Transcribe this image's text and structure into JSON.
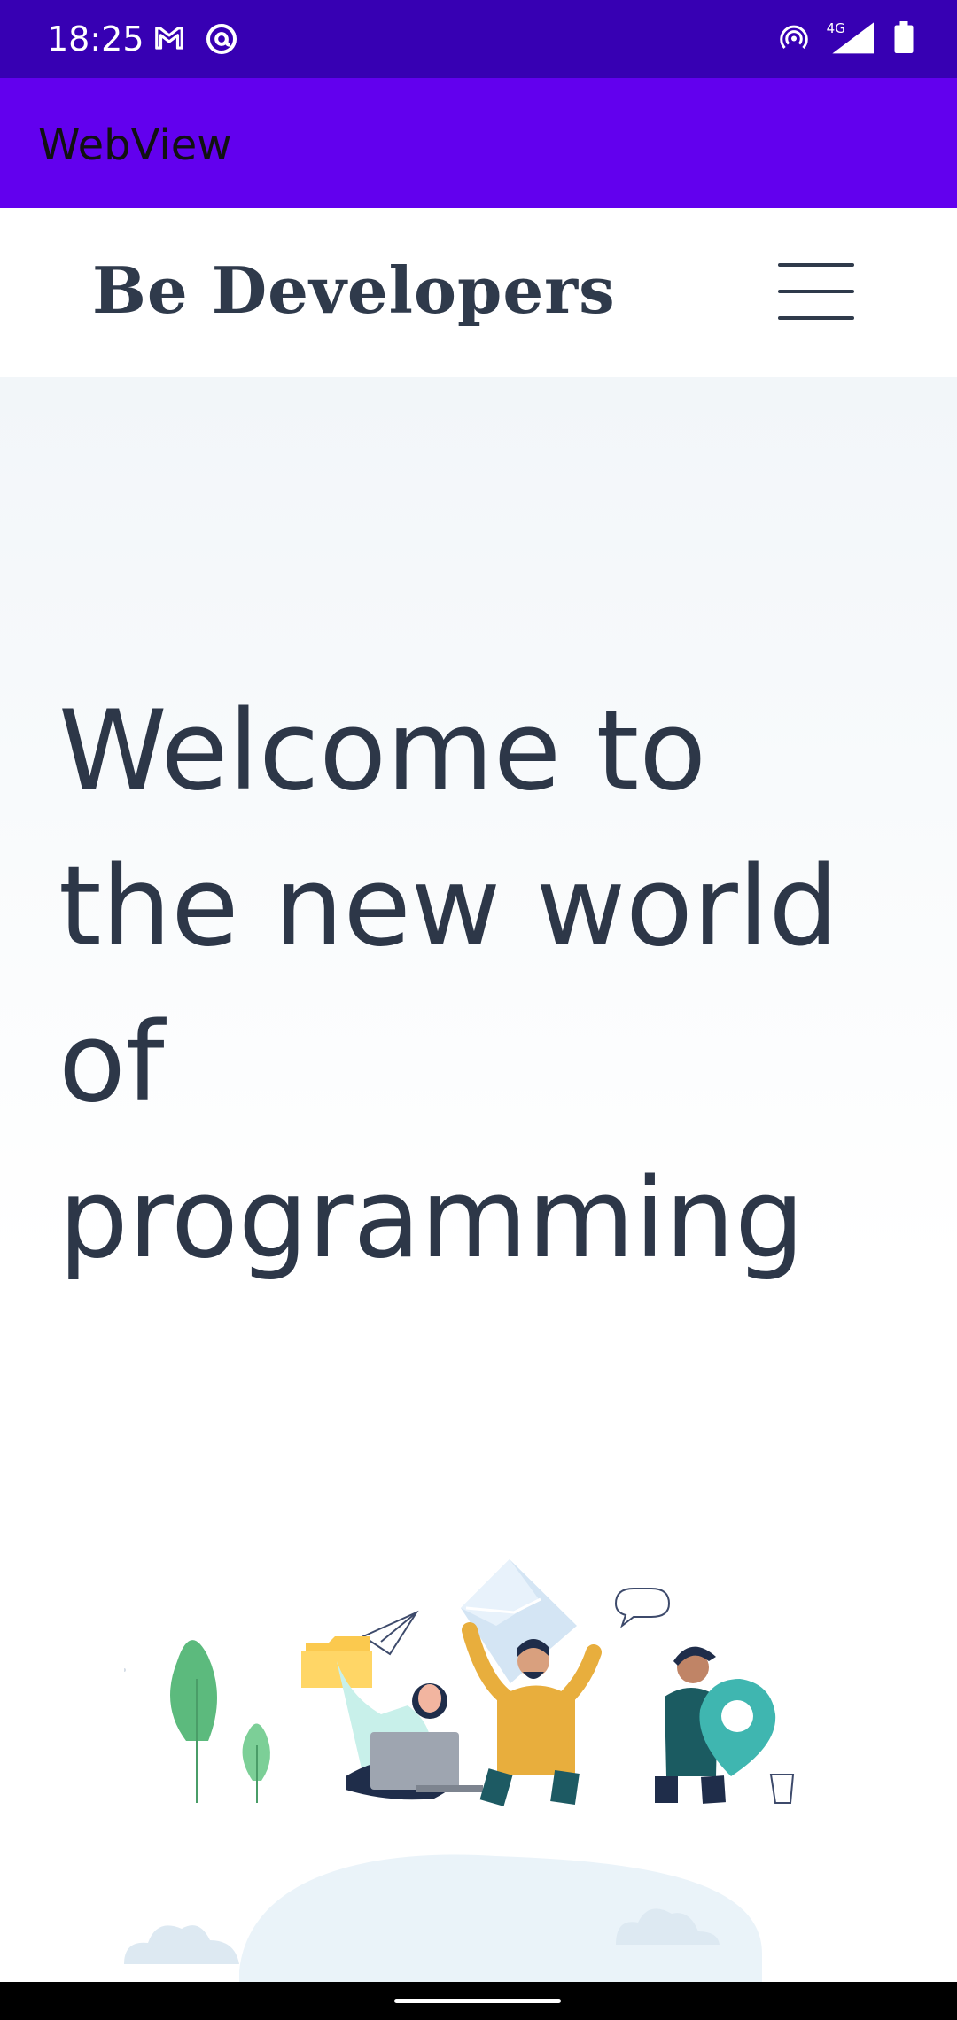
{
  "status_bar": {
    "time": "18:25",
    "icons_left": [
      "gmail-icon",
      "at-sign-icon"
    ],
    "icons_right": [
      "hotspot-icon",
      "4g-icon",
      "signal-icon",
      "battery-icon"
    ],
    "network_label": "4G"
  },
  "app_bar": {
    "title": "WebView"
  },
  "site": {
    "brand": "Be Developers",
    "menu_icon": "hamburger-menu-icon",
    "hero_title": "Welcome to the new world of programming"
  },
  "colors": {
    "status_bar": "#3700b3",
    "app_bar": "#6200ee",
    "heading_text": "#2d3748"
  }
}
